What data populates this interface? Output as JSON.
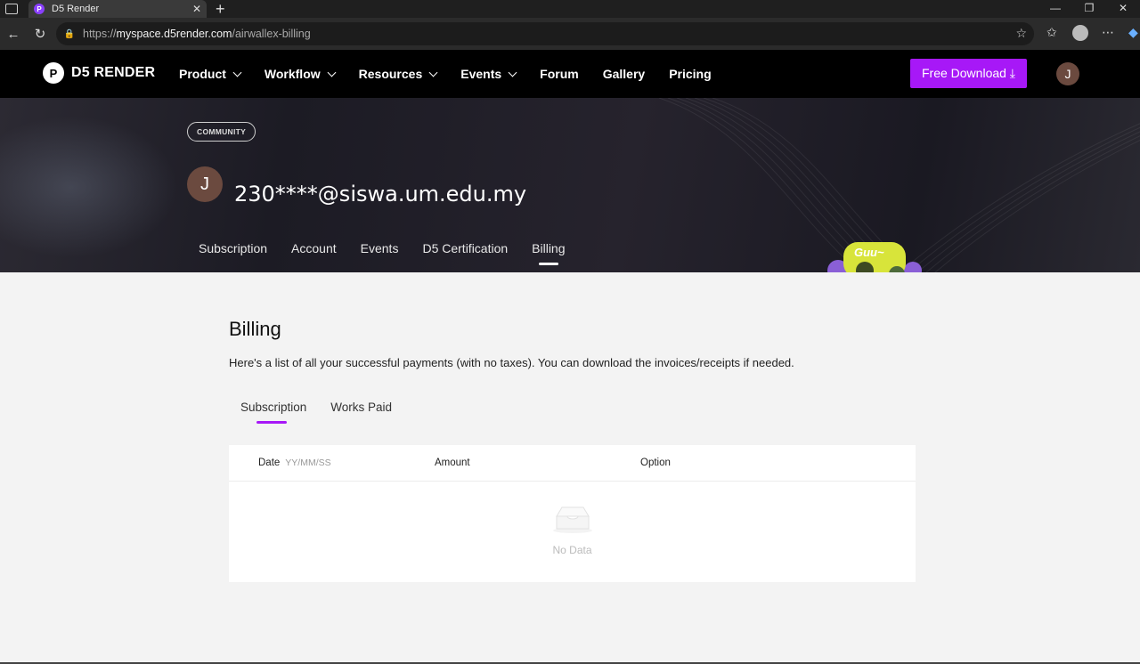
{
  "browser": {
    "tab_title": "D5 Render",
    "tab_favicon_letter": "P",
    "url_prefix": "https://",
    "url_host": "myspace.d5render.com",
    "url_path": "/airwallex-billing"
  },
  "site_nav": {
    "logo_text": "D5 RENDER",
    "items": [
      {
        "label": "Product",
        "dropdown": true
      },
      {
        "label": "Workflow",
        "dropdown": true
      },
      {
        "label": "Resources",
        "dropdown": true
      },
      {
        "label": "Events",
        "dropdown": true
      },
      {
        "label": "Forum",
        "dropdown": false
      },
      {
        "label": "Gallery",
        "dropdown": false
      },
      {
        "label": "Pricing",
        "dropdown": false
      }
    ],
    "download_label": "Free Download ⤓",
    "avatar_letter": "J"
  },
  "hero": {
    "badge": "COMMUNITY",
    "avatar_letter": "J",
    "username": "230****@siswa.um.edu.my",
    "tabs": [
      "Subscription",
      "Account",
      "Events",
      "D5 Certification",
      "Billing"
    ],
    "active_tab": "Billing",
    "mascot_text": "Guu~"
  },
  "billing": {
    "title": "Billing",
    "description": "Here's a list of all your successful payments (with no taxes). You can download the invoices/receipts if needed.",
    "tabs": [
      "Subscription",
      "Works Paid"
    ],
    "active_tab": "Subscription",
    "columns": {
      "date": "Date",
      "date_placeholder": "YY/MM/SS",
      "amount": "Amount",
      "option": "Option"
    },
    "empty_text": "No Data"
  },
  "colors": {
    "accent": "#a718f7",
    "nav_bg": "#000000",
    "page_bg": "#f3f3f3"
  }
}
